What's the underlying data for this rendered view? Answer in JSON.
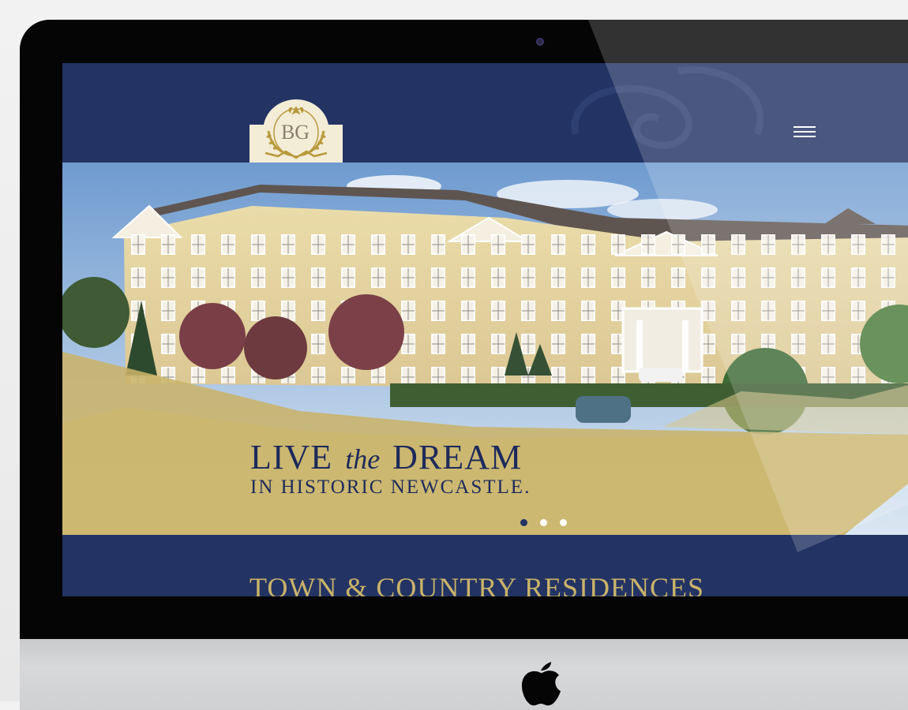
{
  "site": {
    "logo": {
      "monogram": "BG",
      "name": "brand-crest"
    },
    "menu": {
      "icon": "hamburger-menu-icon"
    }
  },
  "hero": {
    "headline": {
      "live": "LIVE",
      "the": "the",
      "dream": "DREAM"
    },
    "subheadline": "IN HISTORIC NEWCASTLE.",
    "slides": {
      "count": 3,
      "active_index": 0
    }
  },
  "section": {
    "title": "TOWN & COUNTRY RESIDENCES"
  },
  "device": {
    "logo": "apple-logo"
  },
  "colors": {
    "navy": "#233363",
    "gold": "#c9b36a",
    "cream": "#f3ecd7"
  }
}
